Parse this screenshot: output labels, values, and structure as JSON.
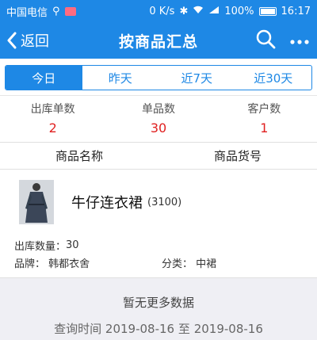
{
  "status_bar": {
    "carrier": "中国电信",
    "speed": "0 K/s",
    "battery": "100%",
    "time": "16:17"
  },
  "navbar": {
    "back_label": "返回",
    "title": "按商品汇总"
  },
  "tabs": [
    {
      "label": "今日",
      "active": true
    },
    {
      "label": "昨天",
      "active": false
    },
    {
      "label": "近7天",
      "active": false
    },
    {
      "label": "近30天",
      "active": false
    }
  ],
  "stats": [
    {
      "label": "出库单数",
      "value": "2"
    },
    {
      "label": "单品数",
      "value": "30"
    },
    {
      "label": "客户数",
      "value": "1"
    }
  ],
  "columns": {
    "name": "商品名称",
    "code": "商品货号"
  },
  "product": {
    "name": "牛仔连衣裙",
    "code": "(3100)",
    "quantity_label": "出库数量：",
    "quantity": "30",
    "brand_label": "品牌：",
    "brand": "韩都衣舍",
    "category_label": "分类：",
    "category": "中裙"
  },
  "footer": {
    "no_more": "暂无更多数据",
    "query_label": "查询时间",
    "from": "2019-08-16",
    "to_word": "至",
    "to": "2019-08-16"
  },
  "colors": {
    "primary": "#1e88e5",
    "value_red": "#e02020"
  }
}
